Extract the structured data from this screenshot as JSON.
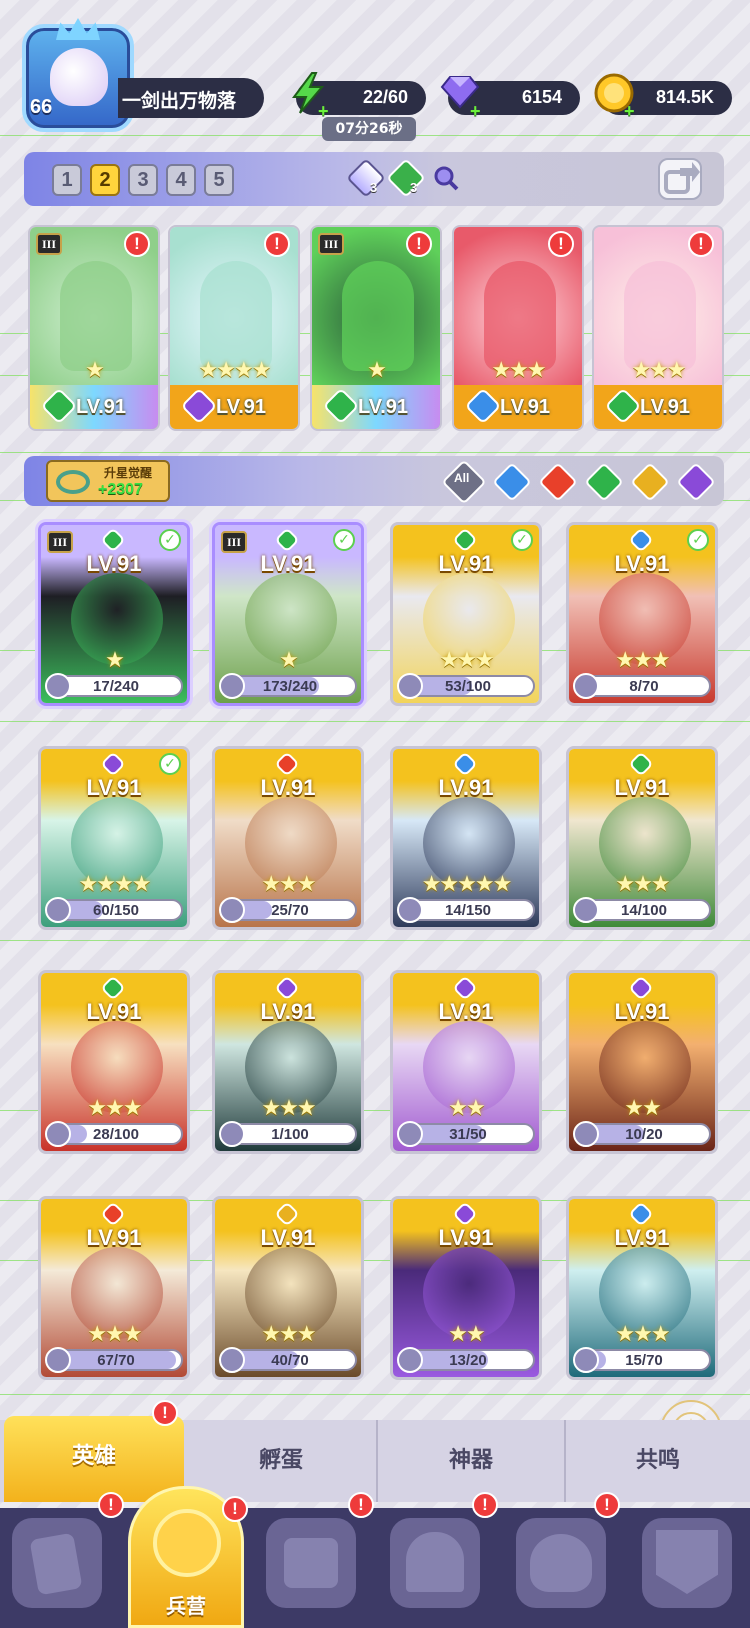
{
  "player": {
    "level": "66",
    "name": "一剑出万物落"
  },
  "resources": {
    "energy": "22/60",
    "energy_timer": "07分26秒",
    "gems": "6154",
    "gold": "814.5K"
  },
  "team_pages": [
    "1",
    "2",
    "3",
    "4",
    "5"
  ],
  "active_page": "2",
  "currency_badges": {
    "crystal_count": "3",
    "green_count": "3"
  },
  "team": [
    {
      "level": "LV.91",
      "element": "wind",
      "tier": "III",
      "stars": 1,
      "colors": [
        "#cfeed0",
        "#8fcf8a"
      ]
    },
    {
      "level": "LV.91",
      "element": "dark",
      "tier": "",
      "stars": 4,
      "colors": [
        "#e8f7ff",
        "#a8e0d0"
      ]
    },
    {
      "level": "LV.91",
      "element": "wind",
      "tier": "III",
      "stars": 1,
      "colors": [
        "#2a5a3a",
        "#5fd05a"
      ]
    },
    {
      "level": "LV.91",
      "element": "water",
      "tier": "",
      "stars": 3,
      "colors": [
        "#ffd6dd",
        "#e85a6a"
      ]
    },
    {
      "level": "LV.91",
      "element": "wind",
      "tier": "",
      "stars": 3,
      "colors": [
        "#fff0e8",
        "#f7c0d8"
      ]
    }
  ],
  "awaken": {
    "label": "升星觉醒",
    "count": "+2307"
  },
  "filters": {
    "all_label": "All",
    "elements": [
      "water",
      "fire",
      "wind",
      "light",
      "dark"
    ]
  },
  "element_colors": {
    "water": "#3a8ee8",
    "fire": "#e8402a",
    "wind": "#2fb34a",
    "light": "#e8b020",
    "dark": "#8a4ad8"
  },
  "heroes": [
    {
      "level": "LV.91",
      "element": "wind",
      "progress": "17/240",
      "frac": 0.07,
      "stars": 1,
      "checked": true,
      "tier": "III",
      "selected": true,
      "colors": [
        "#1e1e24",
        "#3cbf5c"
      ]
    },
    {
      "level": "LV.91",
      "element": "wind",
      "progress": "173/240",
      "frac": 0.72,
      "stars": 1,
      "checked": true,
      "tier": "III",
      "selected": true,
      "colors": [
        "#cfe6c8",
        "#6ca04a"
      ]
    },
    {
      "level": "LV.91",
      "element": "wind",
      "progress": "53/100",
      "frac": 0.53,
      "stars": 3,
      "checked": true,
      "tier": "",
      "selected": false,
      "colors": [
        "#e9e9f0",
        "#f2d45a"
      ]
    },
    {
      "level": "LV.91",
      "element": "water",
      "progress": "8/70",
      "frac": 0.11,
      "stars": 3,
      "checked": true,
      "tier": "",
      "selected": false,
      "colors": [
        "#f1c0b6",
        "#c83a2e"
      ]
    },
    {
      "level": "LV.91",
      "element": "dark",
      "progress": "60/150",
      "frac": 0.4,
      "stars": 4,
      "checked": true,
      "tier": "",
      "selected": false,
      "colors": [
        "#d8f4e8",
        "#3c9f7c"
      ]
    },
    {
      "level": "LV.91",
      "element": "fire",
      "progress": "25/70",
      "frac": 0.36,
      "stars": 3,
      "checked": false,
      "tier": "",
      "selected": false,
      "colors": [
        "#f0dcc8",
        "#b8744a"
      ]
    },
    {
      "level": "LV.91",
      "element": "water",
      "progress": "14/150",
      "frac": 0.09,
      "stars": 5,
      "checked": false,
      "tier": "",
      "selected": false,
      "colors": [
        "#d7e8f7",
        "#2e3a5a"
      ]
    },
    {
      "level": "LV.91",
      "element": "wind",
      "progress": "14/100",
      "frac": 0.14,
      "stars": 3,
      "checked": false,
      "tier": "",
      "selected": false,
      "colors": [
        "#f0e6cf",
        "#3f8a3a"
      ]
    },
    {
      "level": "LV.91",
      "element": "wind",
      "progress": "28/100",
      "frac": 0.28,
      "stars": 3,
      "checked": false,
      "tier": "",
      "selected": false,
      "colors": [
        "#f7e0c0",
        "#c8322a"
      ]
    },
    {
      "level": "LV.91",
      "element": "dark",
      "progress": "1/100",
      "frac": 0.01,
      "stars": 3,
      "checked": false,
      "tier": "",
      "selected": false,
      "colors": [
        "#cfe6e0",
        "#1f3a3a"
      ]
    },
    {
      "level": "LV.91",
      "element": "dark",
      "progress": "31/50",
      "frac": 0.62,
      "stars": 2,
      "checked": false,
      "tier": "",
      "selected": false,
      "colors": [
        "#e8d8f4",
        "#a15ad0"
      ]
    },
    {
      "level": "LV.91",
      "element": "dark",
      "progress": "10/20",
      "frac": 0.5,
      "stars": 2,
      "checked": false,
      "tier": "",
      "selected": false,
      "colors": [
        "#f3b070",
        "#6a2418"
      ]
    },
    {
      "level": "LV.91",
      "element": "fire",
      "progress": "67/70",
      "frac": 0.96,
      "stars": 3,
      "checked": false,
      "tier": "",
      "selected": false,
      "colors": [
        "#f4ead8",
        "#b24a36"
      ]
    },
    {
      "level": "LV.91",
      "element": "light",
      "progress": "40/70",
      "frac": 0.57,
      "stars": 3,
      "checked": false,
      "tier": "",
      "selected": false,
      "colors": [
        "#f6e6c0",
        "#6a4a2a"
      ]
    },
    {
      "level": "LV.91",
      "element": "dark",
      "progress": "13/20",
      "frac": 0.65,
      "stars": 2,
      "checked": false,
      "tier": "",
      "selected": false,
      "colors": [
        "#4a2a7a",
        "#9a5ae0"
      ]
    },
    {
      "level": "LV.91",
      "element": "water",
      "progress": "15/70",
      "frac": 0.21,
      "stars": 3,
      "checked": false,
      "tier": "",
      "selected": false,
      "colors": [
        "#cfeff0",
        "#1f6a7a"
      ]
    }
  ],
  "subtabs": [
    "英雄",
    "孵蛋",
    "神器",
    "共鸣"
  ],
  "nav": {
    "active_label": "兵营"
  }
}
